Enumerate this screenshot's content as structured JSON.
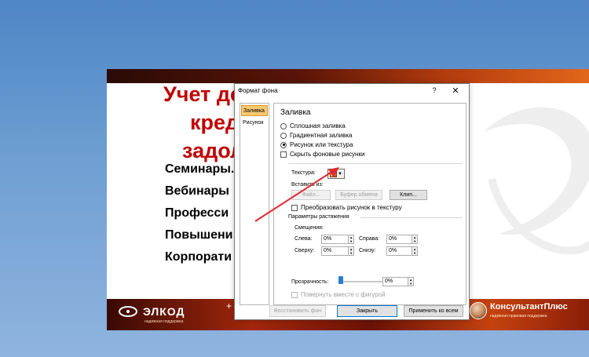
{
  "slide": {
    "title_lines": [
      "Учет де",
      "кред",
      "задол"
    ],
    "bullets": [
      "Семинары.",
      "Вебинары",
      "Професси",
      "Повышени",
      "Корпорати"
    ],
    "footer": {
      "elkod_logo": "ЭЛКОД",
      "elkod_sub": "надежная поддержка",
      "plus_mark": "+",
      "kp_logo": "КонсультантПлюс",
      "kp_sub": "надежная правовая поддержка"
    }
  },
  "dialog": {
    "title": "Формат фона",
    "help": "?",
    "close": "✕",
    "nav": {
      "fill": "Заливка",
      "picture": "Рисунок"
    },
    "section_title": "Заливка",
    "options": {
      "solid": "Сплошная заливка",
      "gradient": "Градиентная заливка",
      "picture_texture": "Рисунок или текстура",
      "hide_bg": "Скрыть фоновые рисунки"
    },
    "texture_label": "Текстура:",
    "insert_from": "Вставить из:",
    "buttons": {
      "file": "Файл...",
      "clipboard": "Буфер обмена",
      "clip": "Клип..."
    },
    "tile_texture": "Преобразовать рисунок в текстуру",
    "stretch_params": "Параметры растяжения",
    "offsets": "Смещения:",
    "left_label": "Слева:",
    "right_label": "Справа:",
    "top_label": "Сверху:",
    "bottom_label": "Снизу:",
    "left_value": "0%",
    "right_value": "0%",
    "top_value": "0%",
    "bottom_value": "0%",
    "transparency_label": "Прозрачность:",
    "transparency_value": "0%",
    "transparency_level": 0,
    "rotate_with_shape": "Повернуть вместе с фигурой",
    "footer": {
      "restore": "Восстановить фон",
      "close": "Закрыть",
      "apply_all": "Применить ко всем"
    }
  },
  "colors": {
    "slide_title": "#c00000",
    "nav_active": "#f6c86f",
    "annotation_arrow": "#e0282e",
    "desktop": "#6f9fd3"
  }
}
